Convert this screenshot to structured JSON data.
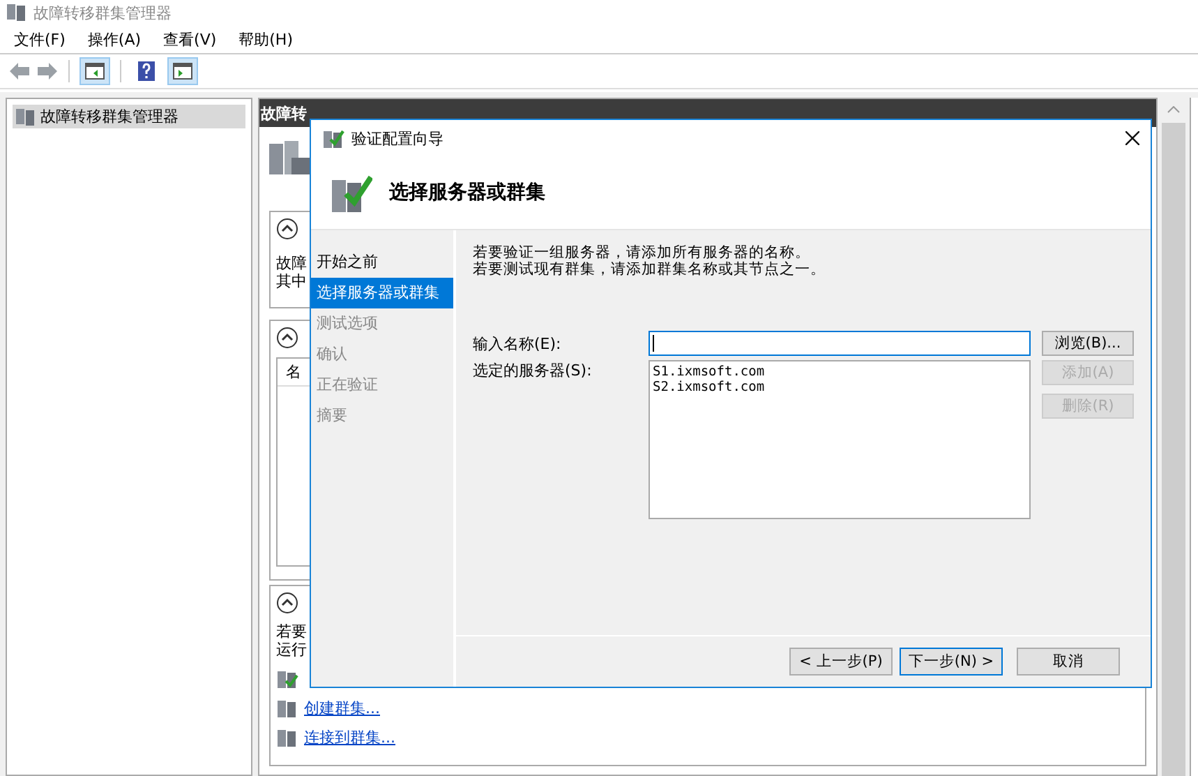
{
  "window": {
    "title": "故障转移群集管理器"
  },
  "menu": [
    "文件(F)",
    "操作(A)",
    "查看(V)",
    "帮助(H)"
  ],
  "toolbar": [
    {
      "kind": "tree-toggle",
      "on": true
    },
    {
      "kind": "help",
      "on": false
    },
    {
      "kind": "action-toggle",
      "on": true
    }
  ],
  "tree": {
    "items": [
      {
        "label": "故障转移群集管理器",
        "selected": true
      }
    ]
  },
  "pane": {
    "header": "故障转",
    "card_1": {
      "lines": [
        "故障",
        "其中"
      ]
    },
    "card_2": {
      "column_1": "名"
    },
    "card_3": {
      "lines": [
        "若要",
        "运行"
      ],
      "links": [
        "创建群集...",
        "连接到群集..."
      ]
    }
  },
  "dialog": {
    "title": "验证配置向导",
    "heading": "选择服务器或群集",
    "steps": [
      {
        "label": "开始之前",
        "selected": false,
        "disabled": false
      },
      {
        "label": "选择服务器或群集",
        "selected": true,
        "disabled": false
      },
      {
        "label": "测试选项",
        "selected": false,
        "disabled": true
      },
      {
        "label": "确认",
        "selected": false,
        "disabled": true
      },
      {
        "label": "正在验证",
        "selected": false,
        "disabled": true
      },
      {
        "label": "摘要",
        "selected": false,
        "disabled": true
      }
    ],
    "instructions": [
      "若要验证一组服务器，请添加所有服务器的名称。",
      "若要测试现有群集，请添加群集名称或其节点之一。"
    ],
    "name_label": "输入名称(E):",
    "servers_label": "选定的服务器(S):",
    "servers": [
      "S1.ixmsoft.com",
      "S2.ixmsoft.com"
    ],
    "side_buttons": [
      {
        "label": "浏览(B)...",
        "disabled": false
      },
      {
        "label": "添加(A)",
        "disabled": true
      },
      {
        "label": "删除(R)",
        "disabled": true
      }
    ],
    "nav_buttons": [
      {
        "label": "< 上一步(P)",
        "default": false
      },
      {
        "label": "下一步(N) >",
        "default": true
      },
      {
        "label": "取消",
        "default": false
      }
    ]
  }
}
